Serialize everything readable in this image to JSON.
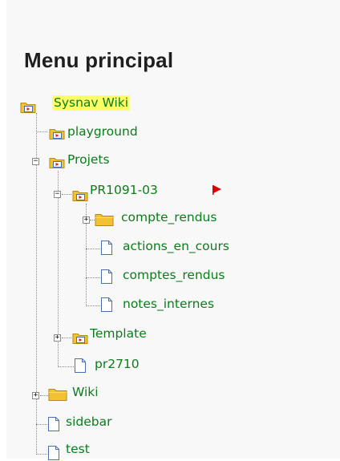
{
  "menu": {
    "title": "Menu principal"
  },
  "tree": {
    "root": {
      "label": "Sysnav Wiki",
      "icon": "folder-page-icon",
      "highlighted": true
    },
    "playground": {
      "label": "playground",
      "icon": "folder-page-icon"
    },
    "projets": {
      "label": "Projets",
      "icon": "folder-page-icon",
      "toggle": "−"
    },
    "pr1091": {
      "label": "PR1091-03",
      "icon": "folder-page-icon",
      "toggle": "−",
      "flag_color": "#e00000"
    },
    "compte_rendus_folder": {
      "label": "compte_rendus",
      "icon": "folder-icon",
      "toggle": "+"
    },
    "actions_en_cours": {
      "label": "actions_en_cours",
      "icon": "page-icon"
    },
    "comptes_rendus": {
      "label": "comptes_rendus",
      "icon": "page-icon"
    },
    "notes_internes": {
      "label": "notes_internes",
      "icon": "page-icon"
    },
    "template": {
      "label": "Template",
      "icon": "folder-page-icon",
      "toggle": "+"
    },
    "pr2710": {
      "label": "pr2710",
      "icon": "page-icon"
    },
    "wiki": {
      "label": "Wiki",
      "icon": "folder-icon",
      "toggle": "+"
    },
    "sidebar": {
      "label": "sidebar",
      "icon": "page-icon"
    },
    "test": {
      "label": "test",
      "icon": "page-icon"
    }
  },
  "colors": {
    "link": "#0b7d1a",
    "highlight": "#ffff66",
    "folder": "#f2c233",
    "page_outline": "#4a6fb0"
  }
}
